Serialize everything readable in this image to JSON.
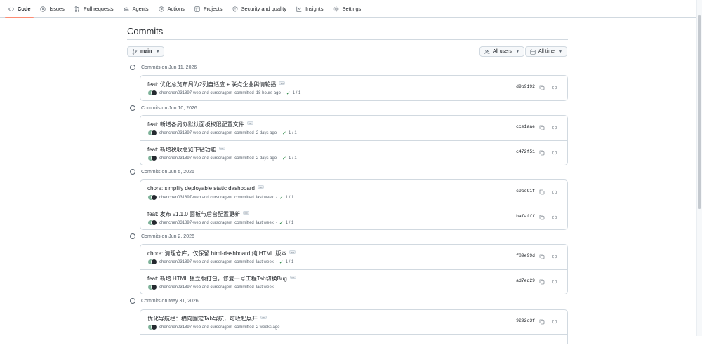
{
  "nav": {
    "tabs": [
      {
        "label": "Code",
        "icon": "code-icon",
        "selected": true
      },
      {
        "label": "Issues",
        "icon": "issue-icon"
      },
      {
        "label": "Pull requests",
        "icon": "pull-request-icon"
      },
      {
        "label": "Agents",
        "icon": "agent-icon"
      },
      {
        "label": "Actions",
        "icon": "play-icon"
      },
      {
        "label": "Projects",
        "icon": "table-icon"
      },
      {
        "label": "Security and quality",
        "icon": "shield-icon"
      },
      {
        "label": "Insights",
        "icon": "graph-icon"
      },
      {
        "label": "Settings",
        "icon": "gear-icon"
      }
    ]
  },
  "page": {
    "title": "Commits"
  },
  "filters": {
    "branch": "main",
    "users": "All users",
    "time": "All time"
  },
  "colors": {
    "accent_tab": "#fd8c73",
    "check_green": "#1a7f37",
    "border": "#d1d9e0"
  },
  "groups": [
    {
      "date": "Commits on Jun 11, 2026",
      "commits": [
        {
          "message": "feat: 优化总览布局为2列自适应 + 联点企业舆情轮播",
          "authors": "chenchen031897-web and cursoragent",
          "verb": "committed",
          "time": "18 hours ago",
          "checks": "1 / 1",
          "sha": "d9b9192"
        }
      ]
    },
    {
      "date": "Commits on Jun 10, 2026",
      "commits": [
        {
          "message": "feat: 新增各局办默认面板权限配置文件",
          "authors": "chenchen031897-web and cursoragent",
          "verb": "committed",
          "time": "2 days ago",
          "checks": "1 / 1",
          "sha": "cce1aae"
        },
        {
          "message": "feat: 新增税收总览下钻功能",
          "authors": "chenchen031897-web and cursoragent",
          "verb": "committed",
          "time": "2 days ago",
          "checks": "1 / 1",
          "sha": "c472f51"
        }
      ]
    },
    {
      "date": "Commits on Jun 5, 2026",
      "commits": [
        {
          "message": "chore: simplify deployable static dashboard",
          "authors": "chenchen031897-web and cursoragent",
          "verb": "committed",
          "time": "last week",
          "checks": "1 / 1",
          "sha": "c9cc91f"
        },
        {
          "message": "feat: 发布 v1.1.0 面板与后台配置更新",
          "authors": "chenchen031897-web and cursoragent",
          "verb": "committed",
          "time": "last week",
          "checks": "1 / 1",
          "sha": "bafafff"
        }
      ]
    },
    {
      "date": "Commits on Jun 2, 2026",
      "commits": [
        {
          "message": "chore: 清理仓库，仅保留 html-dashboard 纯 HTML 版本",
          "authors": "chenchen031897-web and cursoragent",
          "verb": "committed",
          "time": "last week",
          "checks": "1 / 1",
          "sha": "f89e99d"
        },
        {
          "message": "feat: 新增 HTML 独立版打包，修复一号工程Tab切换Bug",
          "authors": "chenchen031897-web and cursoragent",
          "verb": "committed",
          "time": "last week",
          "checks": null,
          "sha": "ad7ed29"
        }
      ]
    },
    {
      "date": "Commits on May 31, 2026",
      "commits": [
        {
          "message": "优化导航栏：横向固定Tab导航，可收起展开",
          "authors": "chenchen031897-web and cursoragent",
          "verb": "committed",
          "time": "2 weeks ago",
          "checks": null,
          "sha": "9292c3f"
        }
      ]
    }
  ]
}
